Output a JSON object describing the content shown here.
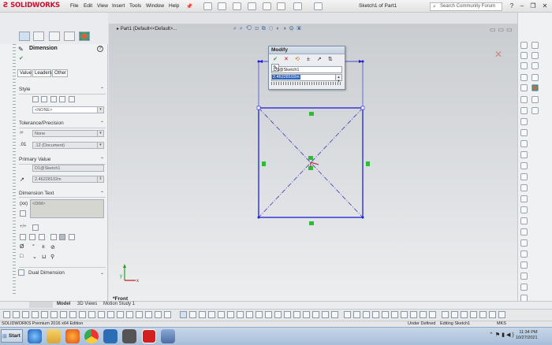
{
  "app": {
    "brand": "SOLIDWORKS",
    "menu": [
      "File",
      "Edit",
      "View",
      "Insert",
      "Tools",
      "Window",
      "Help"
    ],
    "document_title": "Sketch1 of Part1",
    "search_placeholder": "Search Community Forum",
    "window_controls": [
      "?",
      "–",
      "❐",
      "✕"
    ]
  },
  "property_manager": {
    "title": "Dimension",
    "help": "?",
    "subtabs": [
      "Value",
      "Leaders",
      "Other"
    ],
    "sections": {
      "style": {
        "label": "Style",
        "value": "<NONE>"
      },
      "tolerance": {
        "label": "Tolerance/Precision",
        "tolerance_value": "None",
        "precision_value": ".12 (Document)"
      },
      "primary_value": {
        "label": "Primary Value",
        "name": "D1@Sketch1",
        "value": "2.46228102m"
      },
      "dimension_text": {
        "label": "Dimension Text",
        "text": "<DIM>"
      },
      "dual_dimension": {
        "label": "Dual Dimension"
      }
    }
  },
  "viewport": {
    "breadcrumb": "Part1  (Default<<Default>...",
    "view_label": "*Front"
  },
  "modify_dialog": {
    "title": "Modify",
    "dimension_name": "D1@Sketch1",
    "value": "2.46228102m"
  },
  "bottom_tabs": [
    "Model",
    "3D Views",
    "Motion Study 1"
  ],
  "status": {
    "left": "SOLIDWORKS Premium 2016 x64 Edition",
    "state": "Under Defined",
    "editing": "Editing Sketch1",
    "units": "MKS"
  },
  "taskbar": {
    "start": "Start",
    "time": "11:34 PM",
    "date": "10/27/2021"
  },
  "colors": {
    "sketch_line": "#1f1fd6",
    "centerline": "#3a3ab0",
    "relation_green": "#2ebc38",
    "brand_red": "#c8102e"
  }
}
